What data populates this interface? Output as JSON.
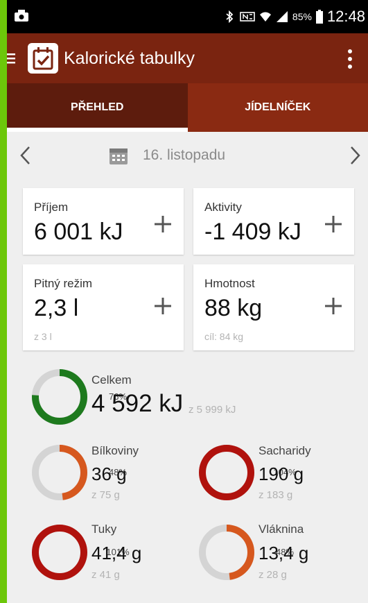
{
  "colors": {
    "frame": "#6cc70a",
    "appbar": "#7a2410",
    "green": "#1e7a1e",
    "orange": "#d6581e",
    "red": "#b0120d",
    "track": "#d4d4d4"
  },
  "status_bar": {
    "battery": "85%",
    "time": "12:48",
    "icons": [
      "photo-icon",
      "bluetooth-icon",
      "nfc-icon",
      "wifi-icon",
      "signal-icon",
      "battery-icon"
    ]
  },
  "app_bar": {
    "title": "Kalorické tabulky",
    "icons": [
      "menu-icon",
      "app-logo-icon",
      "more-vert-icon"
    ]
  },
  "tabs": [
    {
      "label": "PŘEHLED",
      "active": true
    },
    {
      "label": "JÍDELNÍČEK",
      "active": false
    }
  ],
  "date_nav": {
    "date": "16. listopadu"
  },
  "cards": {
    "prijem": {
      "label": "Příjem",
      "value": "6 001 kJ"
    },
    "aktivity": {
      "label": "Aktivity",
      "value": "-1 409 kJ"
    },
    "pitny": {
      "label": "Pitný režim",
      "value": "2,3 l",
      "sub": "z 3 l"
    },
    "hmotnost": {
      "label": "Hmotnost",
      "value": "88 kg",
      "sub": "cíl: 84 kg"
    }
  },
  "summary": {
    "total": {
      "label": "Celkem",
      "value": "4 592 kJ",
      "sub": "z 5 999 kJ",
      "percent_text": "76%",
      "fraction": 0.76,
      "color": "green"
    },
    "bilkoviny": {
      "label": "Bílkoviny",
      "value": "36 g",
      "sub": "z 75 g",
      "percent_text": "48%",
      "fraction": 0.48,
      "color": "orange"
    },
    "sacharidy": {
      "label": "Sacharidy",
      "value": "190 g",
      "sub": "z 183 g",
      "percent_text": "104%",
      "fraction": 1.0,
      "color": "red"
    },
    "tuky": {
      "label": "Tuky",
      "value": "41,4 g",
      "sub": "z 41 g",
      "percent_text": "101%",
      "fraction": 1.0,
      "color": "red"
    },
    "vlaknina": {
      "label": "Vláknina",
      "value": "13,4 g",
      "sub": "z 28 g",
      "percent_text": "48%",
      "fraction": 0.48,
      "color": "orange"
    }
  }
}
